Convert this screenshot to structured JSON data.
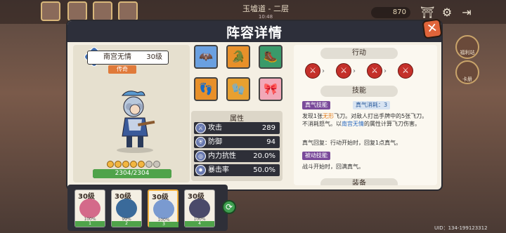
{
  "top": {
    "location": "玉墟道 - 二层",
    "sub": "10:48",
    "coins": "870"
  },
  "side": [
    {
      "label": "福利站"
    },
    {
      "label": "卡册"
    }
  ],
  "panel": {
    "title": "阵容详情"
  },
  "hero": {
    "name": "南宫无情",
    "level": "30级",
    "rarity": "传奇",
    "stars_filled": 5,
    "stars_total": 7,
    "hp_text": "2304/2304",
    "hp_fraction": 1.0
  },
  "equipment": [
    {
      "icon": "🦇",
      "color": "#6aa0e0"
    },
    {
      "icon": "🐊",
      "color": "#e8902a"
    },
    {
      "icon": "🥾",
      "color": "#3a9a6a"
    },
    {
      "icon": "👣",
      "color": "#e8902a"
    },
    {
      "icon": "🧤",
      "color": "#e8a030"
    },
    {
      "icon": "🎀",
      "color": "#f2a8b8"
    }
  ],
  "attributes": {
    "title": "属性",
    "rows": [
      {
        "label": "攻击",
        "value": "289"
      },
      {
        "label": "防御",
        "value": "94"
      },
      {
        "label": "内力抗性",
        "value": "20.0%"
      },
      {
        "label": "暴击率",
        "value": "50.0%"
      }
    ]
  },
  "actions": {
    "title": "行动",
    "count": 4
  },
  "skills": {
    "title": "技能",
    "active_tag": "真气技能",
    "cost_tag": "真气消耗：3",
    "active_desc": "发现1张无形飞刀。对敌人打出手牌中的5张飞刀。不消耗怒气。以南宫无情的属性计算飞刀伤害。",
    "regen": "真气回复：行动开始时，回复1点真气。",
    "passive_tag": "被动技能",
    "passive_desc": "战斗开始时，回满真气。",
    "equip_title": "装备"
  },
  "team": [
    {
      "level": "30级",
      "pct": "100%",
      "num": "1",
      "color": "#d46a8a"
    },
    {
      "level": "30级",
      "pct": "99%",
      "num": "2",
      "color": "#3a6a9a"
    },
    {
      "level": "30级",
      "pct": "100%",
      "num": "3",
      "color": "#7a9ad0"
    },
    {
      "level": "30级",
      "pct": "100%",
      "num": "4",
      "color": "#4a4a6a"
    }
  ],
  "uid": "UID：134-199123312"
}
